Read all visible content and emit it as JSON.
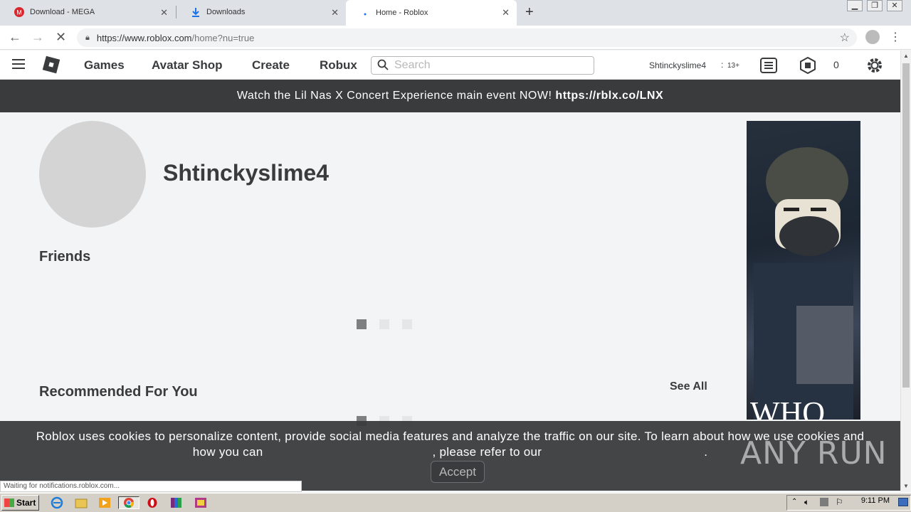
{
  "browser": {
    "tabs": [
      {
        "title": "Download - MEGA",
        "active": false
      },
      {
        "title": "Downloads",
        "active": false
      },
      {
        "title": "Home - Roblox",
        "active": true
      }
    ],
    "url_host": "https://www.roblox.com",
    "url_path": "/home?nu=true",
    "status_text": "Waiting for notifications.roblox.com..."
  },
  "header": {
    "nav": [
      "Games",
      "Avatar Shop",
      "Create",
      "Robux"
    ],
    "search_placeholder": "Search",
    "username": "Shtinckyslime4",
    "age_label": "13+",
    "robux_balance": "0"
  },
  "banner": {
    "text": "Watch the Lil Nas X Concert Experience main event NOW!",
    "link": "https://rblx.co/LNX"
  },
  "profile": {
    "display_name": "Shtinckyslime4"
  },
  "sections": {
    "friends_title": "Friends",
    "recommended_title": "Recommended For You",
    "see_all": "See All"
  },
  "cookie": {
    "line1": "Roblox uses cookies to personalize content, provide social media features and analyze the traffic on our site. To learn about how we use cookies and",
    "line2a": "how you can",
    "line2b": ", please refer to our",
    "line2c": ".",
    "accept": "Accept"
  },
  "watermark": "ANY RUN",
  "taskbar": {
    "start": "Start",
    "clock": "9:11 PM"
  },
  "colors": {
    "banner_bg": "#393b3d",
    "text_dark": "#393b3d",
    "loader_active": "#7f7f7f",
    "loader_inactive": "#e6e6e6"
  }
}
